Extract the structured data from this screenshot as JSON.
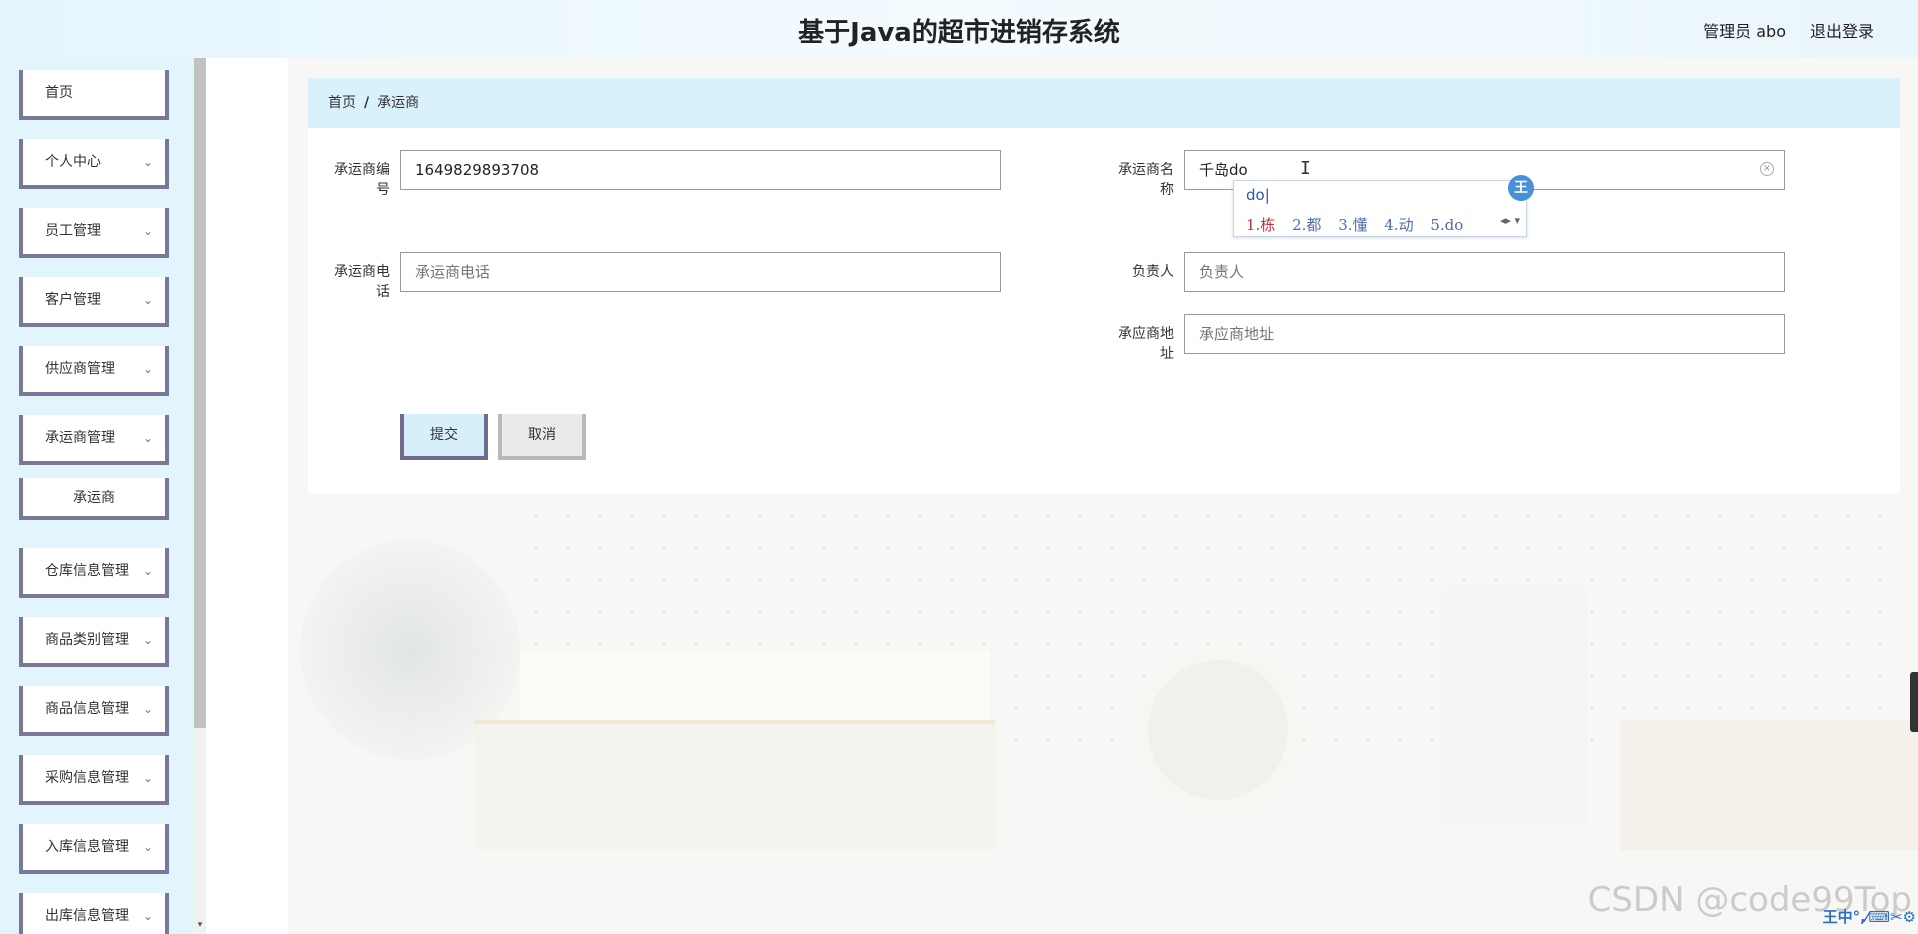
{
  "header": {
    "title": "基于Java的超市进销存系统",
    "user": "管理员 abo",
    "logout": "退出登录"
  },
  "sidebar": {
    "items": [
      {
        "label": "首页",
        "chevron": ""
      },
      {
        "label": "个人中心",
        "chevron": "⌄"
      },
      {
        "label": "员工管理",
        "chevron": "⌄"
      },
      {
        "label": "客户管理",
        "chevron": "⌄"
      },
      {
        "label": "供应商管理",
        "chevron": "⌄"
      },
      {
        "label": "承运商管理",
        "chevron": "⌄"
      },
      {
        "label": "仓库信息管理",
        "chevron": "⌄"
      },
      {
        "label": "商品类别管理",
        "chevron": "⌄"
      },
      {
        "label": "商品信息管理",
        "chevron": "⌄"
      },
      {
        "label": "采购信息管理",
        "chevron": "⌄"
      },
      {
        "label": "入库信息管理",
        "chevron": "⌄"
      },
      {
        "label": "出库信息管理",
        "chevron": "⌄"
      }
    ],
    "sub_item": "承运商",
    "scroll_down": "▾"
  },
  "breadcrumb": {
    "home": "首页",
    "separator": "/",
    "current": "承运商"
  },
  "form": {
    "carrier_id": {
      "label": "承运商编号",
      "value": "1649829893708"
    },
    "carrier_name": {
      "label": "承运商名称",
      "value": "千岛do",
      "clear": "×"
    },
    "carrier_phone": {
      "label": "承运商电话",
      "placeholder": "承运商电话"
    },
    "contact": {
      "label": "负责人",
      "placeholder": "负责人"
    },
    "address": {
      "label": "承应商地址",
      "placeholder": "承应商地址"
    },
    "submit": "提交",
    "cancel": "取消",
    "cursor": "I"
  },
  "ime": {
    "composition": "do|",
    "candidates": [
      "1.栋",
      "2.都",
      "3.懂",
      "4.动",
      "5.do"
    ],
    "nav": "◂▸ ▾",
    "logo": "王"
  },
  "watermark": "CSDN @code99Top",
  "tray": "王中°,⁄⌨✂⚙"
}
